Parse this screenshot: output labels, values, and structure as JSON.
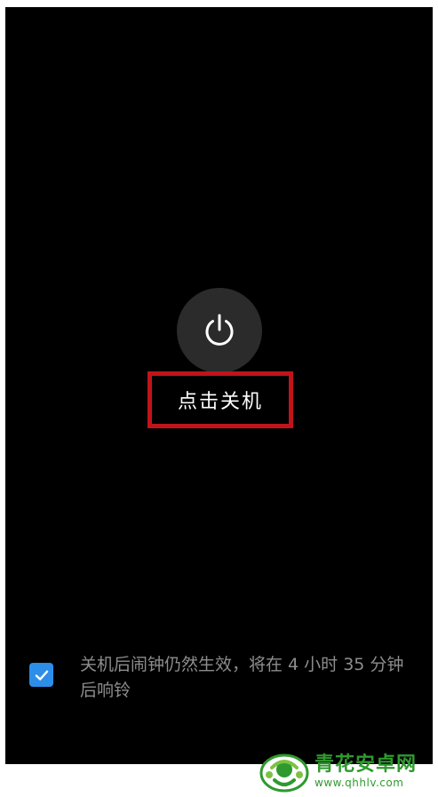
{
  "power_menu": {
    "power_icon": "power-icon",
    "button_label": "点击关机",
    "highlight_color": "#c0141a"
  },
  "alarm_notice": {
    "checked": true,
    "text": "关机后闹钟仍然生效，将在 4 小时 35 分钟后响铃",
    "checkbox_color": "#2c8ee8"
  },
  "watermark": {
    "title": "青花安卓网",
    "url": "www.qhhlv.com"
  }
}
